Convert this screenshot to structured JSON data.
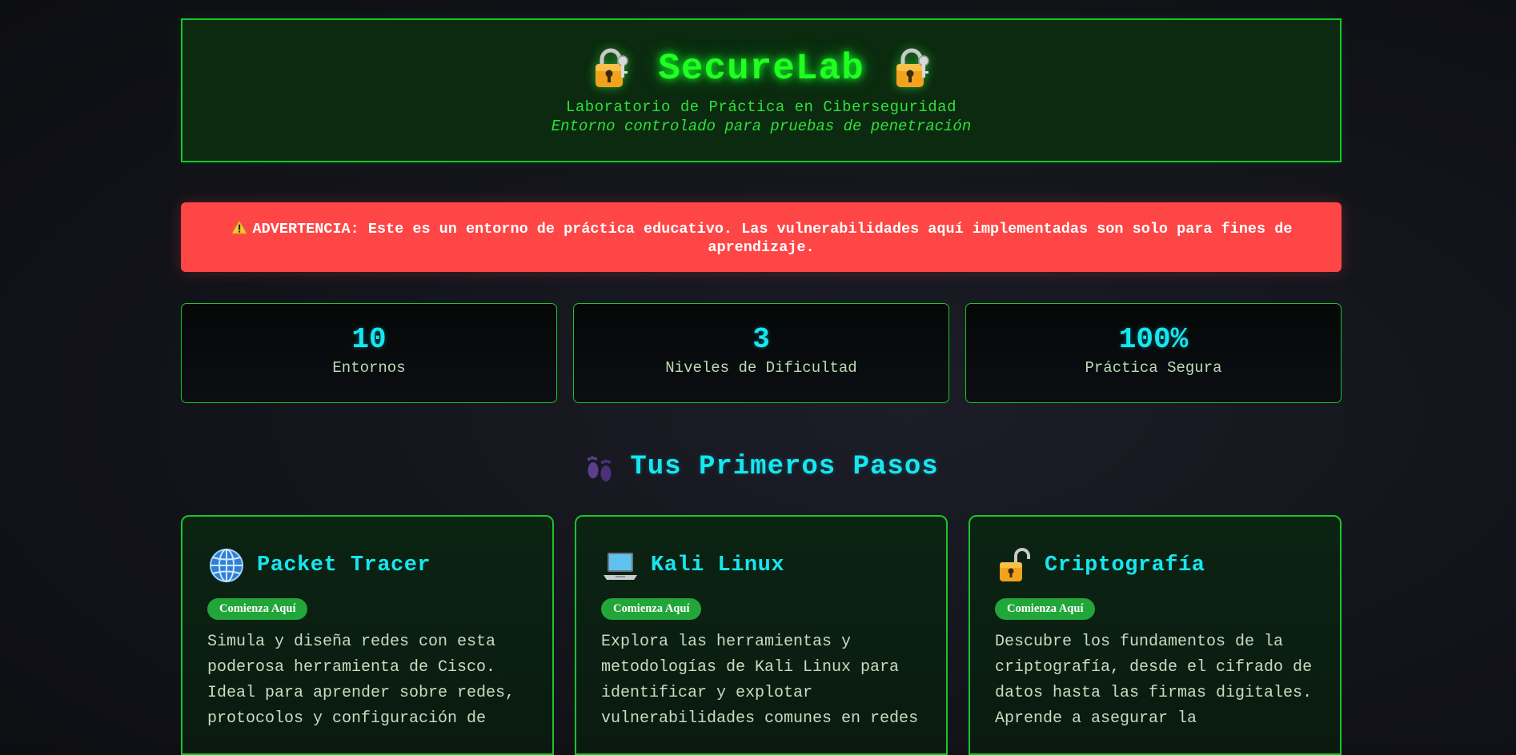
{
  "header": {
    "title": "SecureLab",
    "subtitle": "Laboratorio de Práctica en Ciberseguridad",
    "tagline": "Entorno controlado para pruebas de penetración",
    "icon": "lock-with-key-icon"
  },
  "warning": {
    "icon": "warning-icon",
    "text": "ADVERTENCIA: Este es un entorno de práctica educativo. Las vulnerabilidades aquí implementadas son solo para fines de aprendizaje."
  },
  "stats": [
    {
      "value": "10",
      "label": "Entornos"
    },
    {
      "value": "3",
      "label": "Niveles de Dificultad"
    },
    {
      "value": "100%",
      "label": "Práctica Segura"
    }
  ],
  "section": {
    "icon": "footprints-icon",
    "title": "Tus Primeros Pasos"
  },
  "cards": [
    {
      "icon": "globe-icon",
      "title": "Packet Tracer",
      "badge": "Comienza Aquí",
      "description": "Simula y diseña redes con esta poderosa herramienta de Cisco. Ideal para aprender sobre redes, protocolos y configuración de"
    },
    {
      "icon": "laptop-icon",
      "title": "Kali Linux",
      "badge": "Comienza Aquí",
      "description": "Explora las herramientas y metodologías de Kali Linux para identificar y explotar vulnerabilidades comunes en redes"
    },
    {
      "icon": "open-lock-icon",
      "title": "Criptografía",
      "badge": "Comienza Aquí",
      "description": "Descubre los fundamentos de la criptografía, desde el cifrado de datos hasta las firmas digitales. Aprende a asegurar la"
    }
  ],
  "colors": {
    "neon_green": "#20ff20",
    "border_green": "#18c52a",
    "cyan": "#16e6f0",
    "warning_red": "#ff4646",
    "badge_green": "#22a63a"
  }
}
